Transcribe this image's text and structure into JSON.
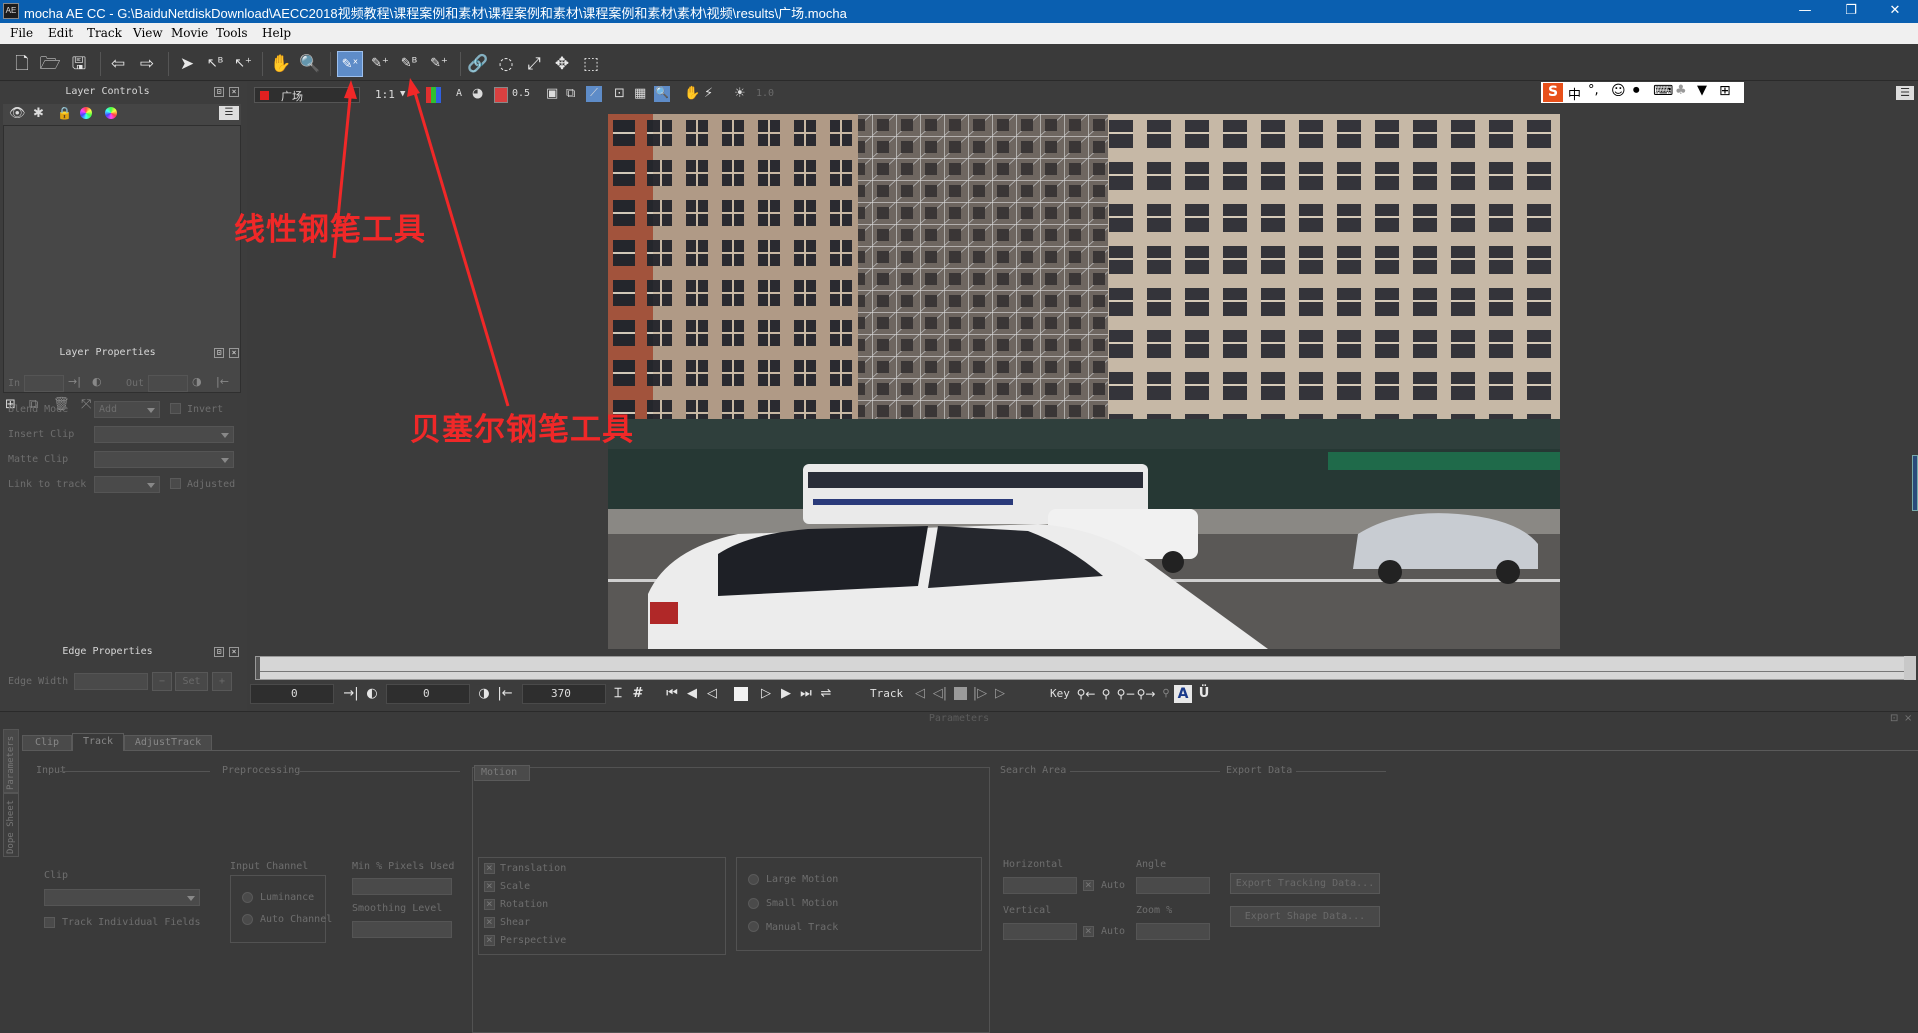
{
  "window": {
    "title": "mocha AE CC - G:\\BaiduNetdiskDownload\\AECC2018视频教程\\课程案例和素材\\课程案例和素材\\课程案例和素材\\素材\\视频\\results\\广场.mocha",
    "app_icon_text": "AE",
    "minimize": "—",
    "restore": "❐",
    "close": "✕"
  },
  "menu": [
    "File",
    "Edit",
    "Track",
    "View",
    "Movie",
    "Tools",
    "Help"
  ],
  "icons": {
    "toolbar": [
      "new-file-icon",
      "open-folder-icon",
      "save-icon",
      "back-arrow-icon",
      "forward-arrow-icon",
      "select-arrow-icon",
      "select-point-icon",
      "add-point-icon",
      "hand-pan-icon",
      "zoom-icon",
      "xspline-pen-icon",
      "add-xspline-icon",
      "bezier-pen-icon",
      "add-bezier-icon",
      "link-icon",
      "lasso-icon",
      "scale-transform-icon",
      "move-icon",
      "marquee-icon"
    ]
  },
  "viewer_toolbar": {
    "clip_name": "广场",
    "clip_color": "#e02020",
    "zoom": "1:1",
    "alpha_label": "A",
    "opacity": "0.5",
    "brightness": "1.0"
  },
  "ime_bar": {
    "logo": "S",
    "items": [
      "中",
      "°,",
      "☺",
      "🎤",
      "⌨",
      "👔",
      "⊞"
    ]
  },
  "layer_controls": {
    "title": "Layer Controls"
  },
  "layer_properties": {
    "title": "Layer Properties",
    "in_label": "In",
    "out_label": "Out",
    "blend_mode_label": "Blend Mode",
    "blend_mode_value": "Add",
    "invert_label": "Invert",
    "insert_clip_label": "Insert Clip",
    "matte_clip_label": "Matte Clip",
    "link_to_track_label": "Link to track",
    "adjusted_label": "Adjusted"
  },
  "edge_properties": {
    "title": "Edge Properties",
    "edge_width_label": "Edge Width",
    "set_label": "Set"
  },
  "transport": {
    "in_frame": "0",
    "current_frame": "0",
    "out_frame": "370",
    "track_label": "Track",
    "key_label": "Key",
    "auto_key_label": "A"
  },
  "parameters": {
    "title": "Parameters",
    "tabs": [
      "Clip",
      "Track",
      "AdjustTrack"
    ],
    "side_tabs": [
      "Parameters",
      "Dope Sheet"
    ],
    "input": {
      "title": "Input",
      "clip_label": "Clip",
      "track_fields_label": "Track Individual Fields"
    },
    "preprocessing": {
      "title": "Preprocessing",
      "input_channel_label": "Input Channel",
      "luminance_label": "Luminance",
      "auto_channel_label": "Auto Channel",
      "min_pixels_label": "Min % Pixels Used",
      "smoothing_label": "Smoothing Level"
    },
    "motion": {
      "title": "Motion",
      "checks": [
        "Translation",
        "Scale",
        "Rotation",
        "Shear",
        "Perspective"
      ],
      "radios": [
        "Large Motion",
        "Small Motion",
        "Manual Track"
      ]
    },
    "search_area": {
      "title": "Search Area",
      "horizontal_label": "Horizontal",
      "vertical_label": "Vertical",
      "auto_label": "Auto",
      "angle_label": "Angle",
      "zoom_label": "Zoom %"
    },
    "export_data": {
      "title": "Export Data",
      "export_tracking": "Export Tracking Data...",
      "export_shape": "Export Shape Data..."
    }
  },
  "annotations": {
    "linear_pen": "线性钢笔工具",
    "bezier_pen": "贝塞尔钢笔工具",
    "color": "#f02828"
  }
}
